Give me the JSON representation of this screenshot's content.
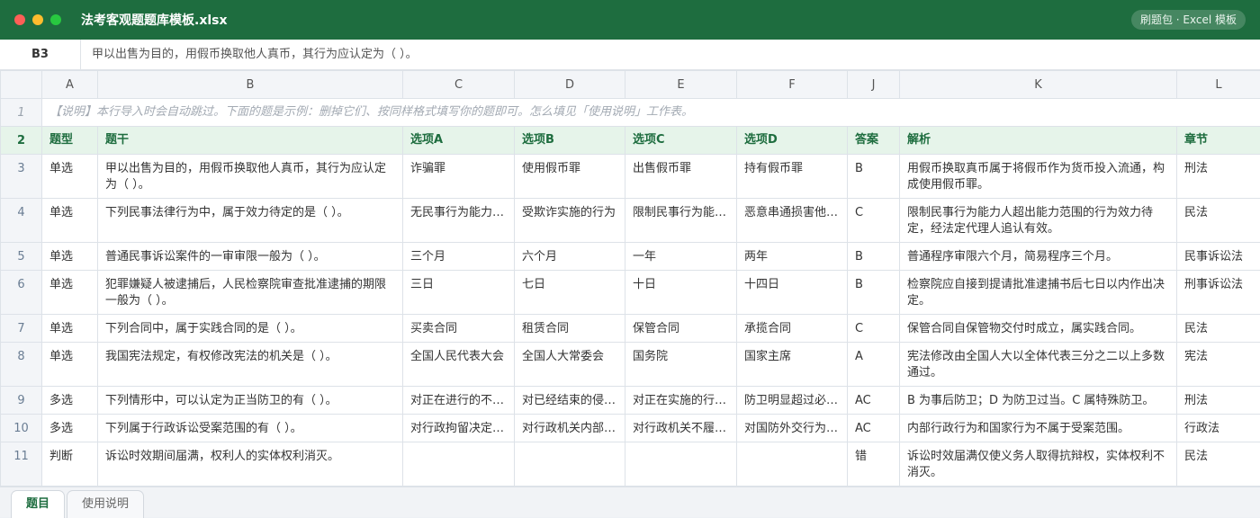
{
  "window": {
    "title": "法考客观题题库模板.xlsx",
    "badge": "刷题包 · Excel 模板"
  },
  "formula_bar": {
    "cell_ref": "B3",
    "content": "甲以出售为目的，用假币换取他人真币，其行为应认定为（ ）。"
  },
  "columns": [
    "A",
    "B",
    "C",
    "D",
    "E",
    "F",
    "J",
    "K",
    "L"
  ],
  "note_row": {
    "num": "1",
    "text": "【说明】本行导入时会自动跳过。下面的题是示例：删掉它们、按同样格式填写你的题即可。怎么填见「使用说明」工作表。"
  },
  "header_row": {
    "num": "2",
    "cells": [
      "题型",
      "题干",
      "选项A",
      "选项B",
      "选项C",
      "选项D",
      "答案",
      "解析",
      "章节"
    ]
  },
  "rows": [
    {
      "num": "3",
      "cells": [
        "单选",
        "甲以出售为目的，用假币换取他人真币，其行为应认定为（ ）。",
        "诈骗罪",
        "使用假币罪",
        "出售假币罪",
        "持有假币罪",
        "B",
        "用假币换取真币属于将假币作为货币投入流通，构成使用假币罪。",
        "刑法"
      ]
    },
    {
      "num": "4",
      "cells": [
        "单选",
        "下列民事法律行为中，属于效力待定的是（ ）。",
        "无民事行为能力…",
        "受欺诈实施的行为",
        "限制民事行为能…",
        "恶意串通损害他…",
        "C",
        "限制民事行为能力人超出能力范围的行为效力待定，经法定代理人追认有效。",
        "民法"
      ]
    },
    {
      "num": "5",
      "cells": [
        "单选",
        "普通民事诉讼案件的一审审限一般为（ ）。",
        "三个月",
        "六个月",
        "一年",
        "两年",
        "B",
        "普通程序审限六个月，简易程序三个月。",
        "民事诉讼法"
      ]
    },
    {
      "num": "6",
      "cells": [
        "单选",
        "犯罪嫌疑人被逮捕后，人民检察院审查批准逮捕的期限一般为（ ）。",
        "三日",
        "七日",
        "十日",
        "十四日",
        "B",
        "检察院应自接到提请批准逮捕书后七日以内作出决定。",
        "刑事诉讼法"
      ]
    },
    {
      "num": "7",
      "cells": [
        "单选",
        "下列合同中，属于实践合同的是（ ）。",
        "买卖合同",
        "租赁合同",
        "保管合同",
        "承揽合同",
        "C",
        "保管合同自保管物交付时成立，属实践合同。",
        "民法"
      ]
    },
    {
      "num": "8",
      "cells": [
        "单选",
        "我国宪法规定，有权修改宪法的机关是（ ）。",
        "全国人民代表大会",
        "全国人大常委会",
        "国务院",
        "国家主席",
        "A",
        "宪法修改由全国人大以全体代表三分之二以上多数通过。",
        "宪法"
      ]
    },
    {
      "num": "9",
      "cells": [
        "多选",
        "下列情形中，可以认定为正当防卫的有（ ）。",
        "对正在进行的不…",
        "对已经结束的侵…",
        "对正在实施的行…",
        "防卫明显超过必…",
        "AC",
        "B 为事后防卫；D 为防卫过当。C 属特殊防卫。",
        "刑法"
      ]
    },
    {
      "num": "10",
      "cells": [
        "多选",
        "下列属于行政诉讼受案范围的有（ ）。",
        "对行政拘留决定…",
        "对行政机关内部…",
        "对行政机关不履…",
        "对国防外交行为…",
        "AC",
        "内部行政行为和国家行为不属于受案范围。",
        "行政法"
      ]
    },
    {
      "num": "11",
      "cells": [
        "判断",
        "诉讼时效期间届满，权利人的实体权利消灭。",
        "",
        "",
        "",
        "",
        "错",
        "诉讼时效届满仅使义务人取得抗辩权，实体权利不消灭。",
        "民法"
      ]
    }
  ],
  "sheet_tabs": [
    "题目",
    "使用说明"
  ],
  "colors": {
    "brand": "#1e6d3f",
    "header_bg": "#e6f4ea"
  }
}
